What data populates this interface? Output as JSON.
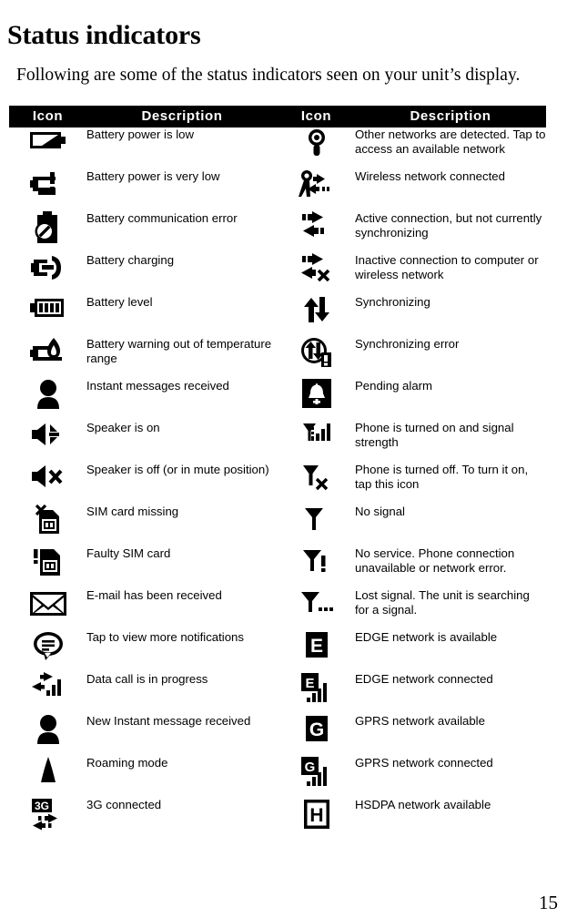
{
  "document": {
    "title": "Status indicators",
    "intro": "Following are some of the status indicators seen on your unit’s display.",
    "page_number": "15"
  },
  "table": {
    "headers": {
      "icon_left": "Icon",
      "description_left": "Description",
      "icon_right": "Icon",
      "description_right": "Description"
    },
    "rows": [
      {
        "left_icon": "battery-low-icon",
        "left_desc": "Battery power is low",
        "right_icon": "other-networks-detected-icon",
        "right_desc": "Other networks are detected. Tap to access an available network"
      },
      {
        "left_icon": "battery-very-low-icon",
        "left_desc": "Battery power is very low",
        "right_icon": "wireless-network-connected-icon",
        "right_desc": "Wireless network connected"
      },
      {
        "left_icon": "battery-communication-error-icon",
        "left_desc": "Battery communication error",
        "right_icon": "active-connection-icon",
        "right_desc": "Active connection, but not currently synchronizing"
      },
      {
        "left_icon": "battery-charging-icon",
        "left_desc": "Battery charging",
        "right_icon": "inactive-connection-icon",
        "right_desc": "Inactive connection to computer or wireless network"
      },
      {
        "left_icon": "battery-level-icon",
        "left_desc": "Battery level",
        "right_icon": "synchronizing-icon",
        "right_desc": "Synchronizing"
      },
      {
        "left_icon": "battery-temperature-warning-icon",
        "left_desc": "Battery warning out of temperature range",
        "right_icon": "synchronizing-error-icon",
        "right_desc": "Synchronizing error"
      },
      {
        "left_icon": "instant-message-received-icon",
        "left_desc": "Instant messages received",
        "right_icon": "pending-alarm-icon",
        "right_desc": "Pending alarm"
      },
      {
        "left_icon": "speaker-on-icon",
        "left_desc": "Speaker is on",
        "right_icon": "signal-strength-icon",
        "right_desc": "Phone is turned on and signal strength"
      },
      {
        "left_icon": "speaker-off-icon",
        "left_desc": "Speaker is off (or in mute position)",
        "right_icon": "phone-off-icon",
        "right_desc": "Phone is turned off. To turn it on, tap this icon"
      },
      {
        "left_icon": "sim-card-missing-icon",
        "left_desc": "SIM card missing",
        "right_icon": "no-signal-icon",
        "right_desc": "No signal"
      },
      {
        "left_icon": "faulty-sim-card-icon",
        "left_desc": "Faulty SIM card",
        "right_icon": "no-service-icon",
        "right_desc": "No service. Phone connection unavailable or network error."
      },
      {
        "left_icon": "email-received-icon",
        "left_desc": "E-mail has been received",
        "right_icon": "lost-signal-icon",
        "right_desc": "Lost signal. The unit is searching for a signal."
      },
      {
        "left_icon": "notifications-icon",
        "left_desc": "Tap to view more notifications",
        "right_icon": "edge-available-icon",
        "right_desc": "EDGE network is available"
      },
      {
        "left_icon": "data-call-in-progress-icon",
        "left_desc": "Data call is in progress",
        "right_icon": "edge-connected-icon",
        "right_desc": "EDGE network connected"
      },
      {
        "left_icon": "new-instant-message-icon",
        "left_desc": "New Instant message received",
        "right_icon": "gprs-available-icon",
        "right_desc": "GPRS network available"
      },
      {
        "left_icon": "roaming-mode-icon",
        "left_desc": "Roaming mode",
        "right_icon": "gprs-connected-icon",
        "right_desc": "GPRS network connected"
      },
      {
        "left_icon": "three-g-connected-icon",
        "left_desc": "3G connected",
        "right_icon": "hsdpa-available-icon",
        "right_desc": "HSDPA network available"
      }
    ]
  },
  "colors": {
    "ink": "#000000",
    "paper": "#ffffff",
    "header_bar": "#000000",
    "header_text": "#ffffff"
  }
}
